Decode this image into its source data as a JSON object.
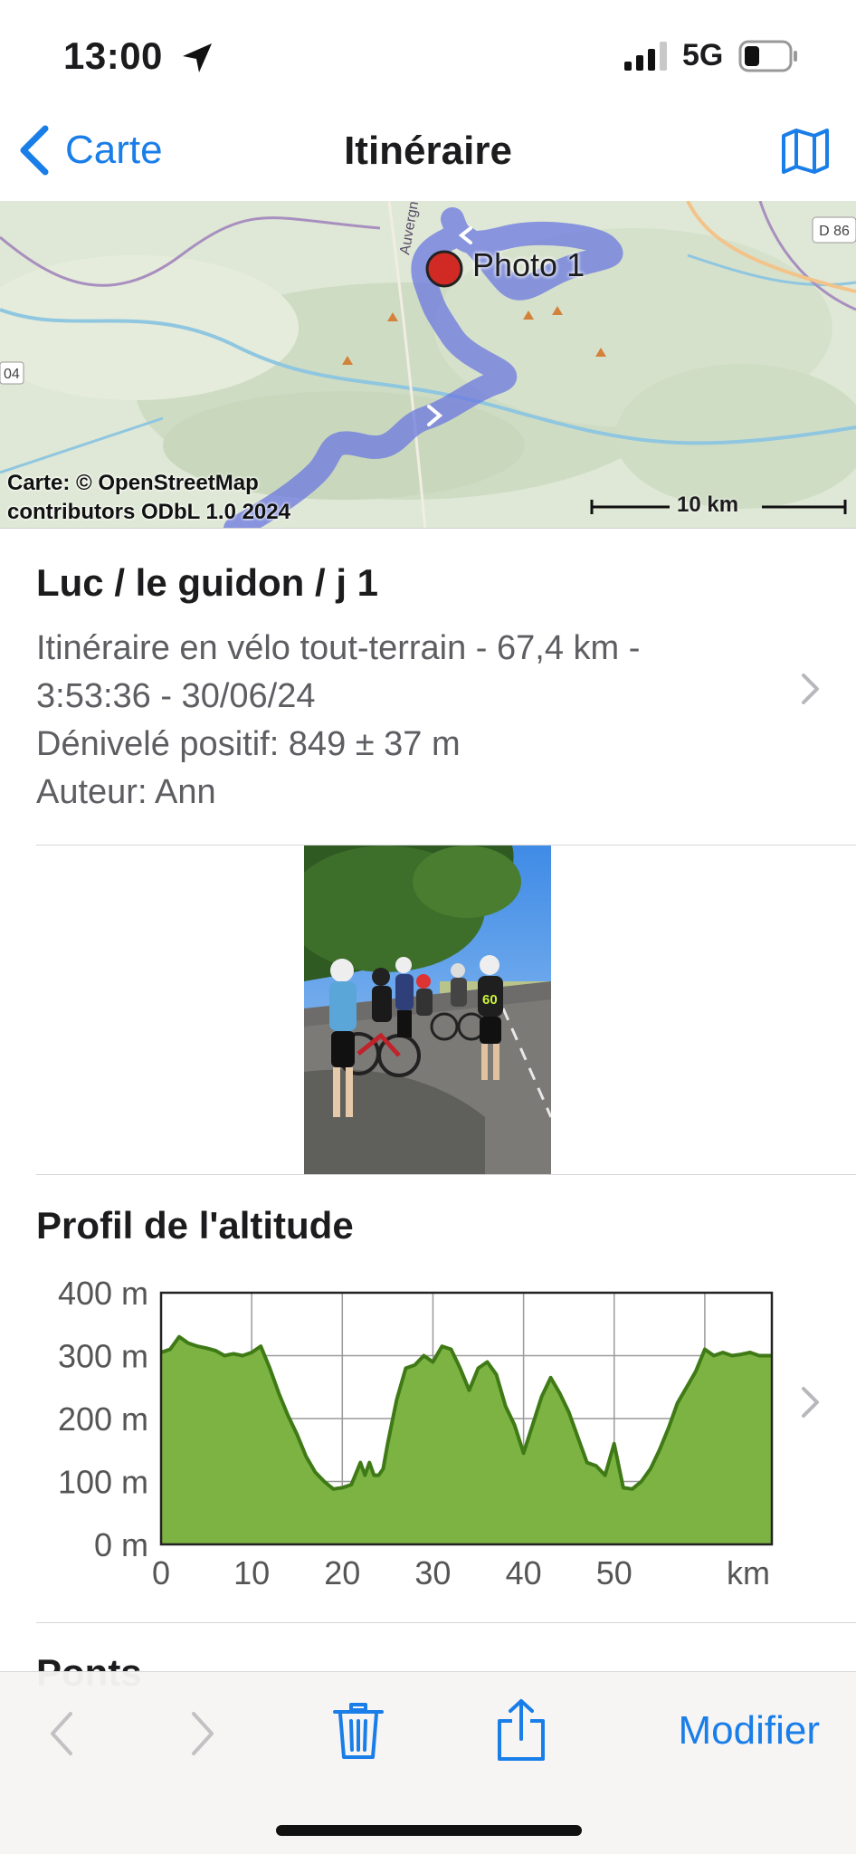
{
  "status_bar": {
    "time": "13:00",
    "network": "5G"
  },
  "nav": {
    "back_label": "Carte",
    "title": "Itinéraire",
    "map_icon": "map-icon"
  },
  "map": {
    "marker_label": "Photo 1",
    "attribution_line1": "Carte: © OpenStreetMap",
    "attribution_line2": "contributors ODbL 1.0 2024",
    "scale_label": "10 km",
    "road_label": "D 86",
    "side_label": "04",
    "place_label": "Auvergn",
    "route_color": "#6b78e0"
  },
  "route": {
    "title": "Luc / le guidon / j 1",
    "line1": "Itinéraire en vélo tout-terrain - 67,4 km -",
    "line2": "3:53:36 - 30/06/24",
    "line3": "Dénivelé positif: 849 ± 37 m",
    "line4": "Auteur: Ann"
  },
  "elevation": {
    "title": "Profil de l'altitude"
  },
  "chart_data": {
    "type": "area",
    "title": "Profil de l'altitude",
    "xlabel": "km",
    "ylabel": "",
    "x_ticks": [
      "0",
      "10",
      "20",
      "30",
      "40",
      "50",
      "km"
    ],
    "y_ticks": [
      "400 m",
      "300 m",
      "200 m",
      "100 m",
      "0 m"
    ],
    "xlim": [
      0,
      67.4
    ],
    "ylim": [
      0,
      400
    ],
    "grid": true,
    "fill_color": "#7cb342",
    "line_color": "#3f7a16",
    "x": [
      0,
      1,
      2,
      3,
      4,
      5,
      6,
      7,
      8,
      9,
      10,
      11,
      12,
      13,
      14,
      15,
      16,
      17,
      18,
      19,
      20,
      21,
      22,
      22.5,
      23,
      23.5,
      24,
      24.5,
      25,
      26,
      27,
      28,
      29,
      30,
      31,
      32,
      33,
      34,
      35,
      36,
      37,
      38,
      39,
      40,
      41,
      42,
      43,
      44,
      45,
      46,
      47,
      48,
      49,
      50,
      51,
      52,
      53,
      54,
      55,
      56,
      57,
      58,
      59,
      60,
      61,
      62,
      63,
      64,
      65,
      66,
      67.4
    ],
    "y": [
      305,
      310,
      330,
      320,
      315,
      312,
      308,
      300,
      303,
      300,
      305,
      315,
      280,
      240,
      205,
      175,
      140,
      115,
      100,
      88,
      90,
      95,
      130,
      110,
      130,
      110,
      110,
      120,
      160,
      230,
      280,
      285,
      300,
      290,
      315,
      310,
      280,
      245,
      280,
      290,
      270,
      220,
      190,
      145,
      190,
      235,
      265,
      240,
      210,
      170,
      130,
      125,
      110,
      160,
      90,
      88,
      100,
      120,
      150,
      185,
      225,
      250,
      275,
      310,
      300,
      305,
      300,
      302,
      305,
      300,
      300
    ]
  },
  "next_section": {
    "title": "Ponts"
  },
  "toolbar": {
    "back_icon": "chevron-left-icon",
    "forward_icon": "chevron-right-icon",
    "trash_icon": "trash-icon",
    "share_icon": "share-icon",
    "modify_label": "Modifier",
    "accent": "#1a7ee8"
  }
}
